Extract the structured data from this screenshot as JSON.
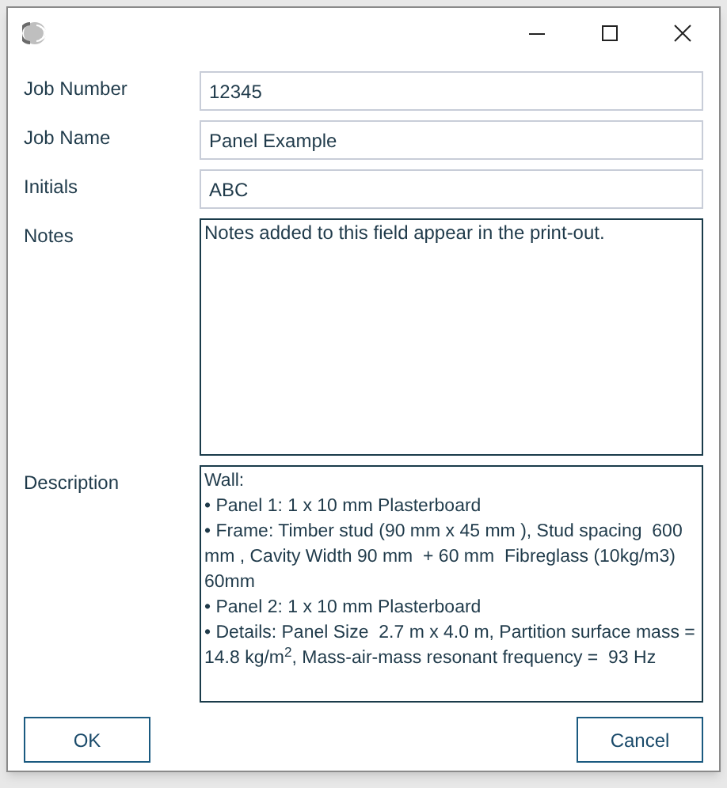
{
  "fields": [
    {
      "label": "Job Number",
      "value": "12345",
      "kind": "line"
    },
    {
      "label": "Job Name",
      "value": "Panel Example",
      "kind": "line"
    },
    {
      "label": "Initials",
      "value": "ABC",
      "kind": "line"
    },
    {
      "label": "Notes",
      "value": "Notes added to this field appear in the print-out.",
      "kind": "area"
    }
  ],
  "description": {
    "label": "Description",
    "lines": [
      "Wall:",
      "• Panel 1: 1 x 10 mm Plasterboard",
      "• Frame: Timber stud (90 mm x 45 mm ), Stud spacing  600 mm , Cavity Width 90 mm  + 60 mm  Fibreglass (10kg/m3) 60mm",
      "• Panel 2: 1 x 10 mm Plasterboard",
      "• Details: Panel Size  2.7 m x 4.0 m, Partition surface mass = 14.8 kg/m$^{2}$, Mass-air-mass resonant frequency =  93 Hz"
    ]
  },
  "buttons": [
    "OK",
    "Cancel"
  ]
}
